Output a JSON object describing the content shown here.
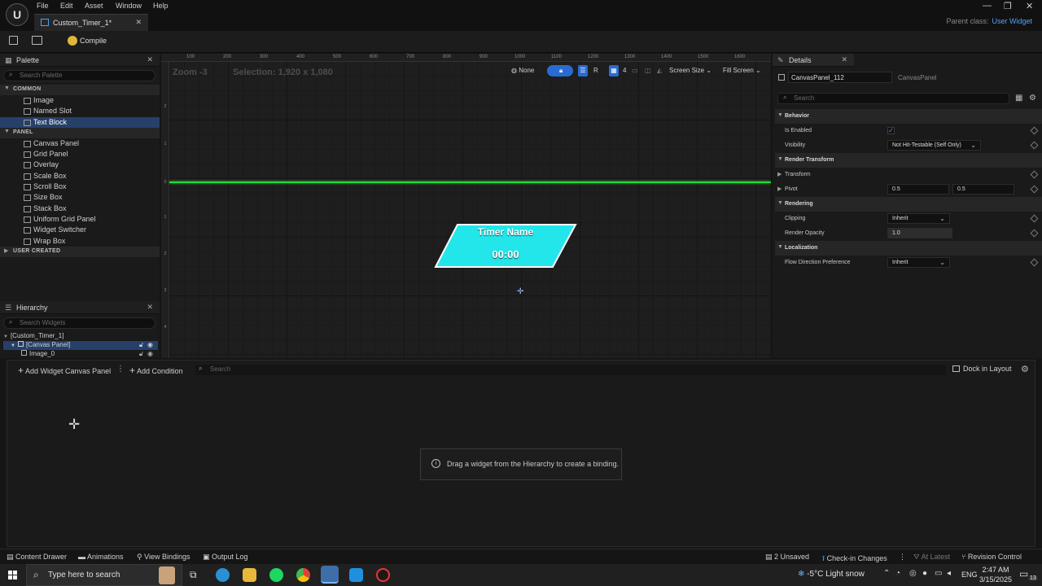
{
  "app": {
    "logo": "U",
    "menu": [
      "File",
      "Edit",
      "Asset",
      "Window",
      "Help"
    ],
    "tab_title": "Custom_Timer_1*",
    "parent_class_label": "Parent class:",
    "parent_class_value": "User Widget",
    "window_controls": [
      "—",
      "❐",
      "✕"
    ]
  },
  "toolbar": {
    "compile_label": "Compile"
  },
  "palette": {
    "title": "Palette",
    "search_placeholder": "Search Palette",
    "categories": {
      "common": "COMMON",
      "panel": "PANEL",
      "user_created": "USER CREATED"
    },
    "common_items": [
      "Image",
      "Named Slot",
      "Text Block"
    ],
    "panel_items": [
      "Canvas Panel",
      "Grid Panel",
      "Overlay",
      "Scale Box",
      "Scroll Box",
      "Size Box",
      "Stack Box",
      "Uniform Grid Panel",
      "Widget Switcher",
      "Wrap Box"
    ],
    "selected_item": "Text Block"
  },
  "hierarchy": {
    "title": "Hierarchy",
    "search_placeholder": "Search Widgets",
    "root": "[Custom_Timer_1]",
    "canvas": "[Canvas Panel]",
    "child": "Image_0"
  },
  "viewport": {
    "zoom": "Zoom -3",
    "selection": "Selection: 1,920 x 1,080",
    "ruler_x": [
      "100",
      "200",
      "300",
      "400",
      "500",
      "600",
      "700",
      "800",
      "900",
      "1000",
      "1100",
      "1200",
      "1300",
      "1400",
      "1500",
      "1600"
    ],
    "ruler_y": [
      "2",
      "1",
      "0",
      "1",
      "2",
      "3",
      "4"
    ],
    "widget_title": "Timer Name",
    "widget_time": "00:00",
    "tools": {
      "none": "None",
      "r": "R",
      "grid_count": "4",
      "screen_size": "Screen Size",
      "fill_screen": "Fill Screen"
    },
    "widget_color": "#22e6ea"
  },
  "details": {
    "title": "Details",
    "name_value": "CanvasPanel_112",
    "type_label": "CanvasPanel",
    "search_placeholder": "Search",
    "behavior": {
      "header": "Behavior",
      "is_enabled_label": "Is Enabled",
      "visibility_label": "Visibility",
      "visibility_value": "Not Hit-Testable (Self Only)"
    },
    "render_transform": {
      "header": "Render Transform",
      "transform_label": "Transform",
      "pivot_label": "Pivot",
      "pivot_x": "0.5",
      "pivot_y": "0.5"
    },
    "rendering": {
      "header": "Rendering",
      "clipping_label": "Clipping",
      "clipping_value": "Inherit",
      "opacity_label": "Render Opacity",
      "opacity_value": "1.0"
    },
    "localization": {
      "header": "Localization",
      "flow_label": "Flow Direction Preference",
      "flow_value": "Inherit"
    }
  },
  "bindings": {
    "add_widget_label": "Add Widget Canvas Panel",
    "add_condition_label": "Add Condition",
    "search_placeholder": "Search",
    "dock_label": "Dock in Layout",
    "hint": "Drag a widget from the Hierarchy to create a binding."
  },
  "statusbar": {
    "content_drawer": "Content Drawer",
    "animations": "Animations",
    "view_bindings": "View Bindings",
    "output_log": "Output Log",
    "unsaved": "2 Unsaved",
    "check_in": "Check-in Changes",
    "at_latest": "At Latest",
    "revision_control": "Revision Control"
  },
  "taskbar": {
    "search_placeholder": "Type here to search",
    "weather": "-5°C  Light snow",
    "language": "ENG",
    "time": "2:47 AM",
    "date": "3/15/2025",
    "notification_count": "13"
  }
}
